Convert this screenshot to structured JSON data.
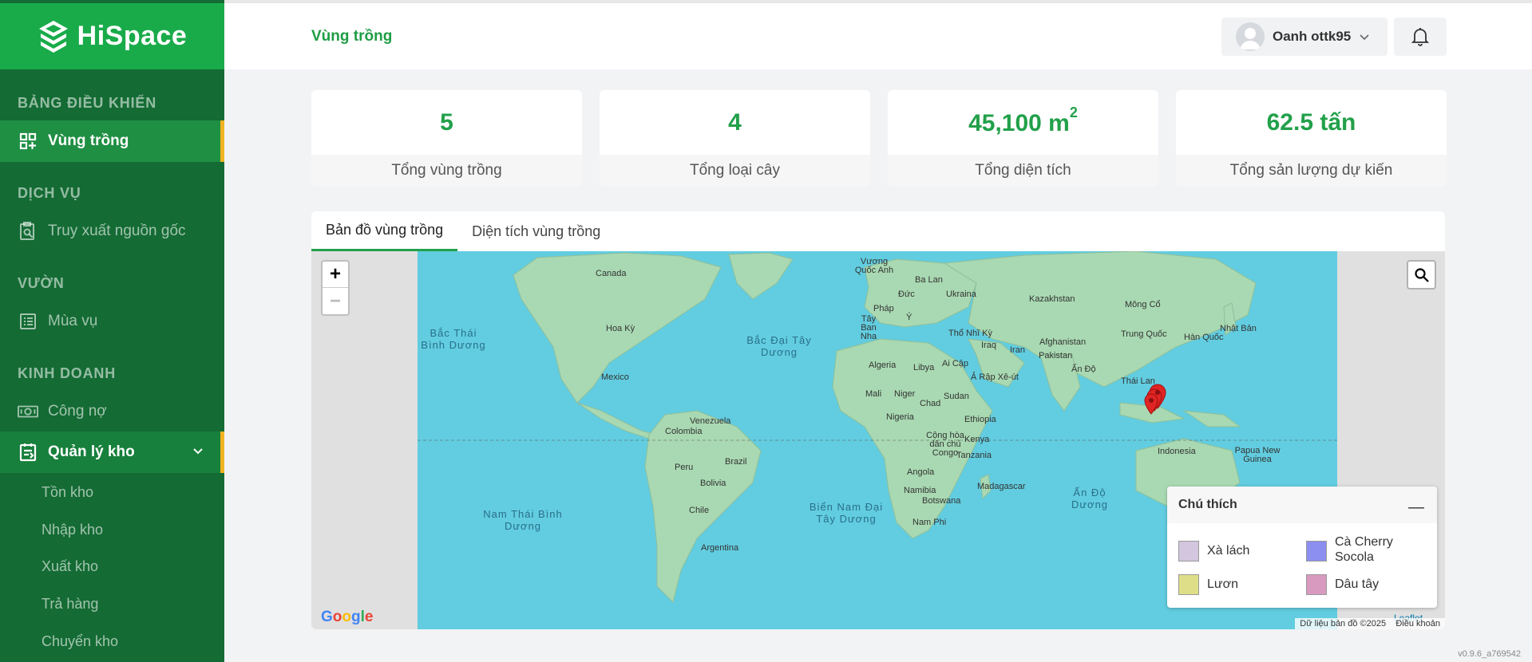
{
  "brand": {
    "name": "HiSpace"
  },
  "sidebar": {
    "sections": [
      {
        "title": "BẢNG ĐIỀU KHIỂN"
      },
      {
        "title": "DỊCH VỤ"
      },
      {
        "title": "VƯỜN"
      },
      {
        "title": "KINH DOANH"
      }
    ],
    "items": [
      {
        "label": "Vùng trồng",
        "icon": "grid-icon",
        "active": true
      },
      {
        "label": "Truy xuất nguồn gốc",
        "icon": "trace-icon"
      },
      {
        "label": "Mùa vụ",
        "icon": "list-icon"
      },
      {
        "label": "Công nợ",
        "icon": "money-icon"
      },
      {
        "label": "Quản lý kho",
        "icon": "warehouse-icon",
        "expanded": true
      }
    ],
    "sub_items": [
      {
        "label": "Tồn kho"
      },
      {
        "label": "Nhập kho"
      },
      {
        "label": "Xuất kho"
      },
      {
        "label": "Trả hàng"
      },
      {
        "label": "Chuyển kho"
      }
    ]
  },
  "header": {
    "title": "Vùng trồng",
    "user": {
      "name": "Oanh ottk95"
    }
  },
  "stats": [
    {
      "value": "5",
      "label": "Tổng vùng trồng"
    },
    {
      "value": "4",
      "label": "Tổng loại cây"
    },
    {
      "value": "45,100 m",
      "sup": "2",
      "label": "Tổng diện tích"
    },
    {
      "value": "62.5 tấn",
      "label": "Tổng sản lượng dự kiến"
    }
  ],
  "tabs": [
    {
      "label": "Bản đồ vùng trồng",
      "active": true
    },
    {
      "label": "Diện tích vùng trồng"
    }
  ],
  "map": {
    "ocean_labels": [
      "Bắc Thái Bình Dương",
      "Bắc Đại Tây Dương",
      "Nam Thái Bình Dương",
      "Biển Nam Đại Tây Dương",
      "Ấn Độ Dương"
    ],
    "country_labels": [
      "Canada",
      "Hoa Kỳ",
      "Mexico",
      "Venezuela",
      "Colombia",
      "Brazil",
      "Peru",
      "Bolivia",
      "Chile",
      "Argentina",
      "Vương Quốc Anh",
      "Ba Lan",
      "Đức",
      "Pháp",
      "Tây Ban Nha",
      "Ý",
      "Ukraina",
      "Kazakhstan",
      "Mông Cổ",
      "Thổ Nhĩ Kỳ",
      "Iraq",
      "Iran",
      "Afghanistan",
      "Pakistan",
      "Trung Quốc",
      "Hàn Quốc",
      "Nhật Bản",
      "Ấn Độ",
      "Thái Lan",
      "Indonesia",
      "Papua New Guinea",
      "Algeria",
      "Libya",
      "Ai Cập",
      "Ả Rập Xê-út",
      "Mali",
      "Niger",
      "Chad",
      "Sudan",
      "Nigeria",
      "Ethiopia",
      "Cộng hòa dân chủ Congo",
      "Kenya",
      "Tanzania",
      "Angola",
      "Namibia",
      "Botswana",
      "Nam Phi",
      "Madagascar"
    ],
    "markers_count": 5,
    "google_logo": "Google",
    "attribution": "Dữ liệu bản đồ ©2025",
    "terms": "Điều khoản",
    "leaflet": "Leaflet"
  },
  "legend": {
    "title": "Chú thích",
    "items": [
      {
        "label": "Xà lách",
        "color": "#d4c6de"
      },
      {
        "label": "Cà Cherry Socola",
        "color": "#8c8ff0"
      },
      {
        "label": "Lươn",
        "color": "#dede88"
      },
      {
        "label": "Dâu tây",
        "color": "#d99ac0"
      }
    ]
  },
  "version": "v0.9.6_a769542"
}
